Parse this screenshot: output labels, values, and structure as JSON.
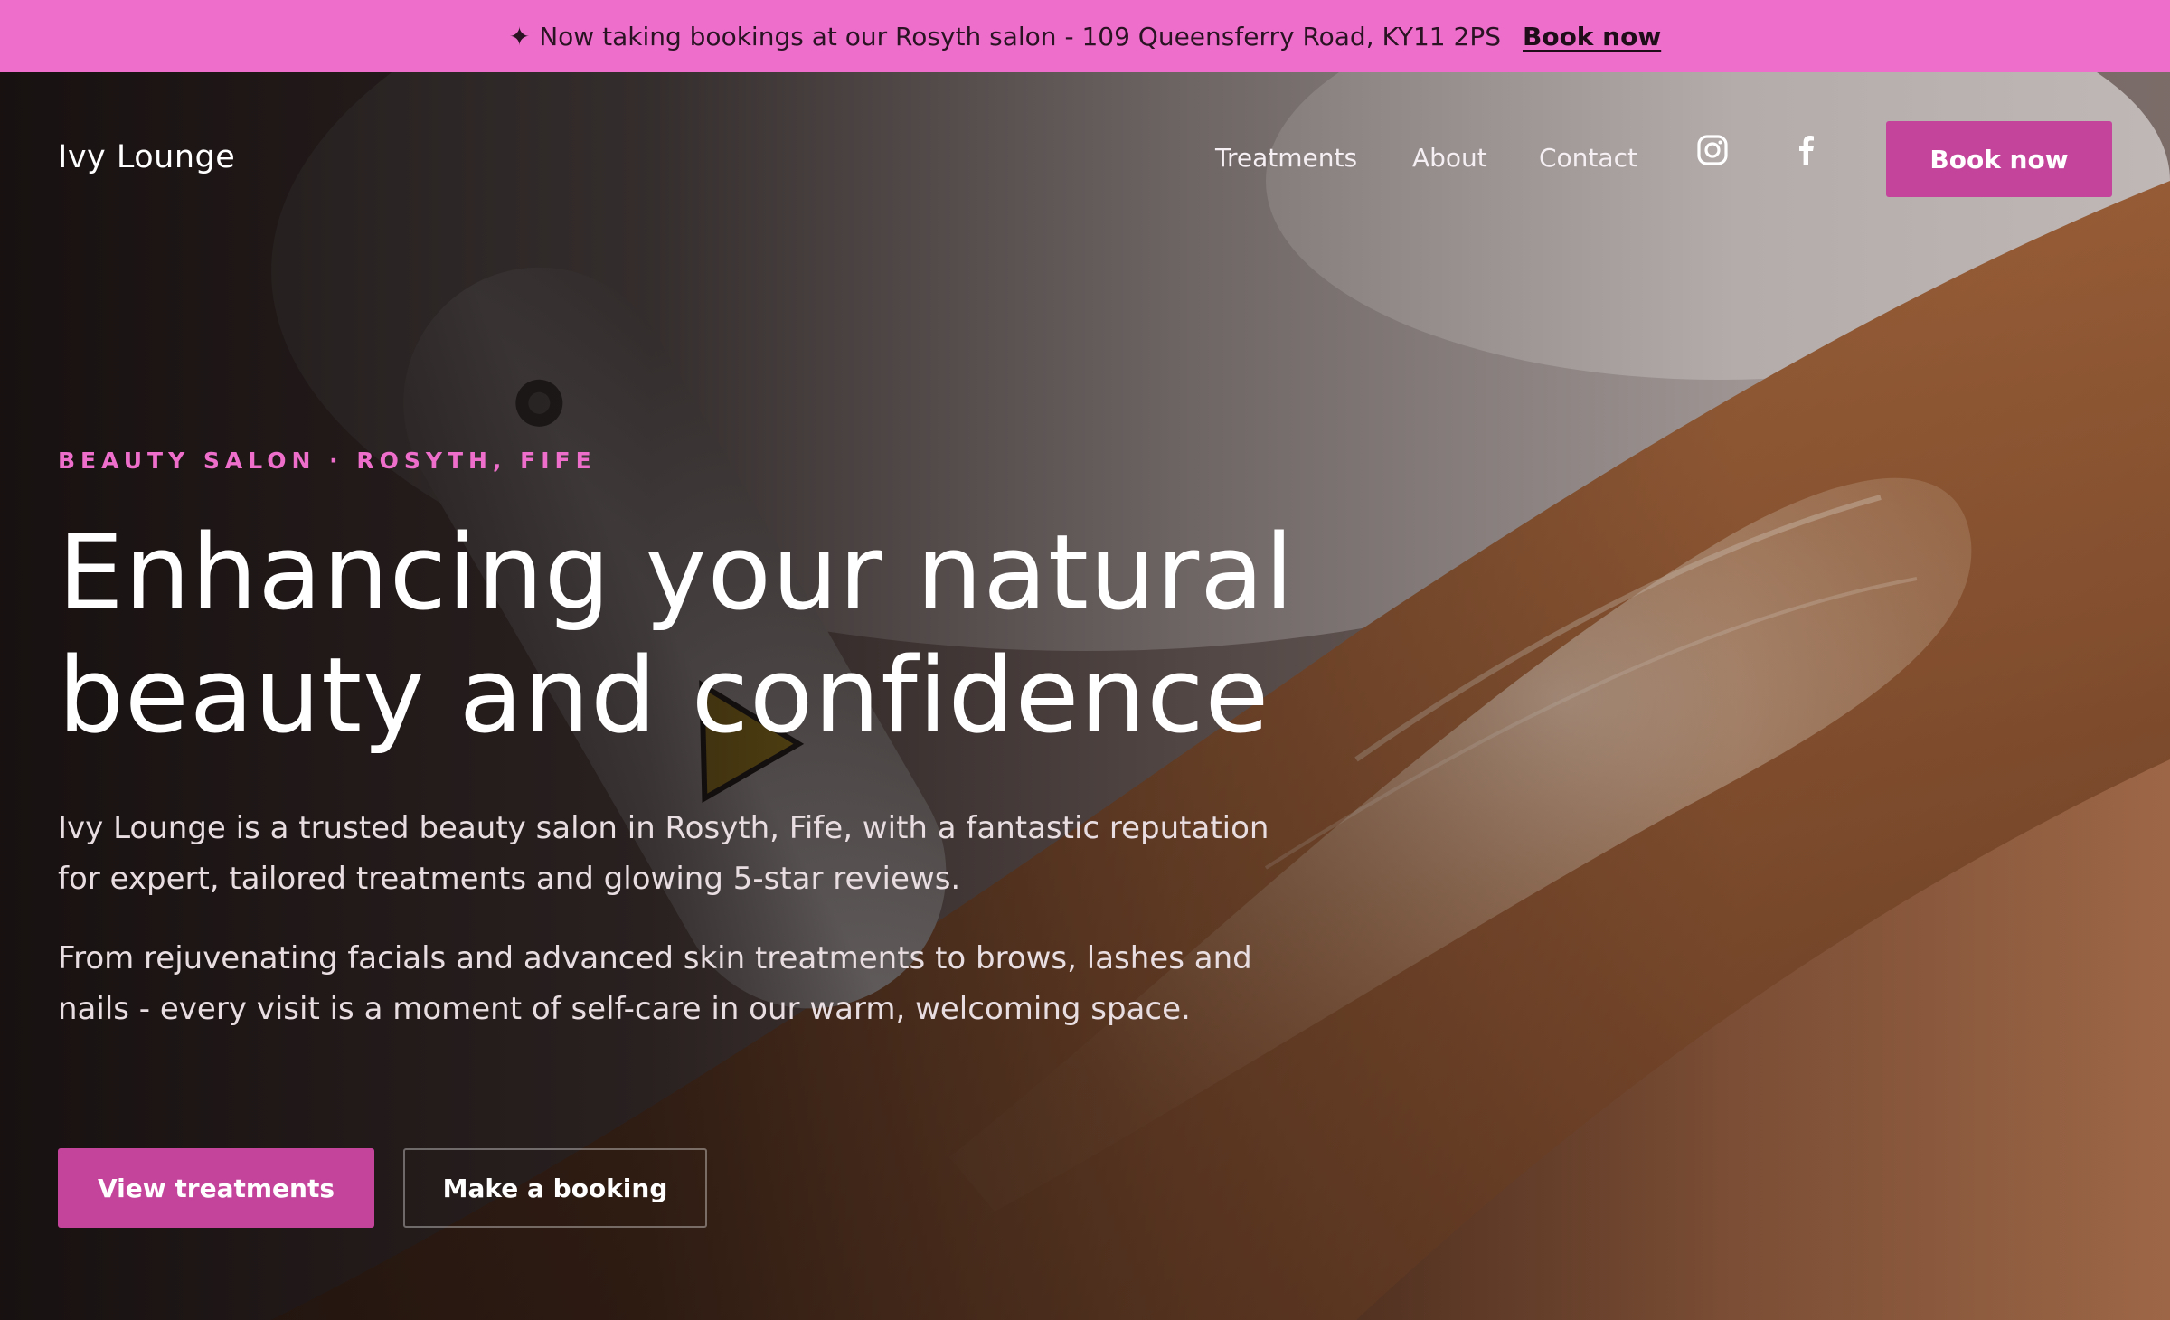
{
  "announcement": {
    "sparkle": "✦",
    "message": "Now taking bookings at our Rosyth salon - 109 Queensferry Road, KY11 2PS",
    "link_label": "Book now"
  },
  "nav": {
    "brand": "Ivy Lounge",
    "links": [
      "Treatments",
      "About",
      "Contact"
    ],
    "icons": [
      "instagram-icon",
      "facebook-icon"
    ],
    "cta_label": "Book now"
  },
  "hero": {
    "eyebrow": "BEAUTY SALON · ROSYTH, FIFE",
    "headline_line1": "Enhancing your natural",
    "headline_line2": "beauty and confidence",
    "paragraph1": "Ivy Lounge is a trusted beauty salon in Rosyth, Fife, with a fantastic reputation for expert, tailored treatments and glowing 5-star reviews.",
    "paragraph2": "From rejuvenating facials and advanced skin treatments to brows, lashes and nails - every visit is a moment of self-care in our warm, welcoming space.",
    "primary_cta": "View treatments",
    "secondary_cta": "Make a booking"
  },
  "colors": {
    "announcement_bg": "#ee6fcb",
    "accent": "#c4439b",
    "eyebrow": "#ee6fcb"
  }
}
